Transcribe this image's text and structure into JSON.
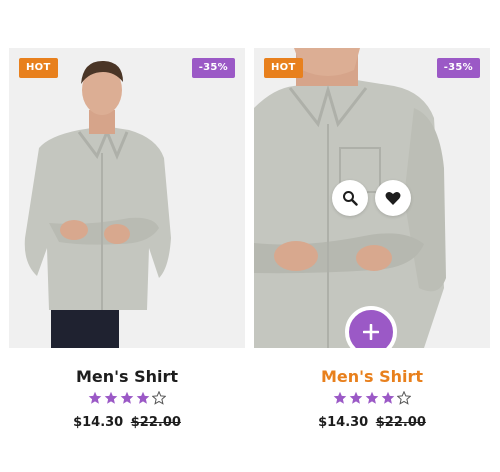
{
  "colors": {
    "accent_purple": "#9b59c6",
    "accent_orange": "#e8801d",
    "text_dark": "#1d1d1d",
    "image_bg": "#f0f0f0"
  },
  "products": [
    {
      "hot_badge": "HOT",
      "discount_badge": "-35%",
      "title": "Men's Shirt",
      "rating": 4,
      "rating_max": 5,
      "price_current": "$14.30",
      "price_old": "$22.00",
      "hovered": false
    },
    {
      "hot_badge": "HOT",
      "discount_badge": "-35%",
      "title": "Men's Shirt",
      "rating": 4,
      "rating_max": 5,
      "price_current": "$14.30",
      "price_old": "$22.00",
      "hovered": true,
      "actions": {
        "quick_view_icon": "search-icon",
        "wishlist_icon": "heart-icon",
        "add_to_cart_icon": "plus-icon"
      }
    }
  ]
}
